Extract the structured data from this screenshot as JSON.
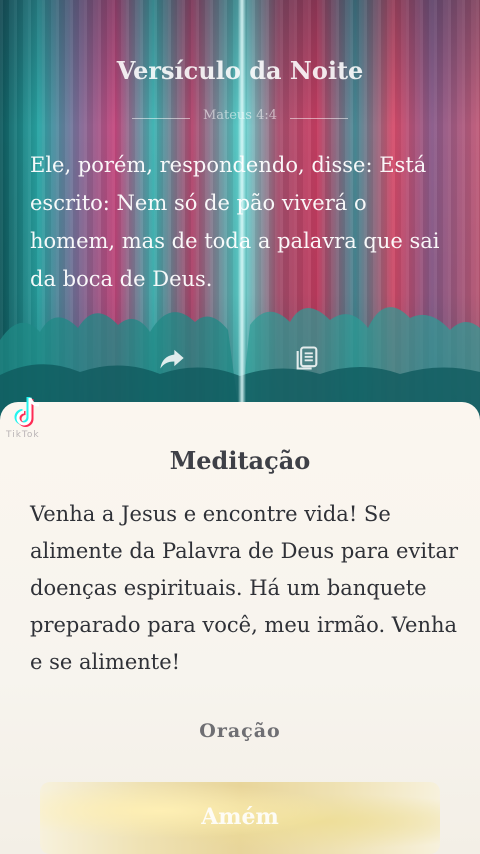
{
  "verse": {
    "title": "Versículo da Noite",
    "reference": "Mateus 4:4",
    "text": "Ele, porém, respondendo, disse: Está escrito: Nem só de pão viverá o homem, mas de toda a palavra que sai da boca de Deus."
  },
  "actions": {
    "share_icon": "share-arrow-icon",
    "notes_icon": "notes-icon"
  },
  "overlay": {
    "app": "TikTok",
    "watermark": "TikTok"
  },
  "meditation": {
    "title": "Meditação",
    "text": "Venha a Jesus e encontre vida! Se alimente da Palavra de Deus para evitar doenças espirituais. Há um banquete preparado para você, meu irmão. Venha e se alimente!"
  },
  "prayer": {
    "label": "Oração"
  },
  "amen_button": {
    "label": "Amém"
  },
  "colors": {
    "sheet_background": "#f7f4ee",
    "title_text": "#3e4047",
    "body_text": "#2f3137"
  }
}
